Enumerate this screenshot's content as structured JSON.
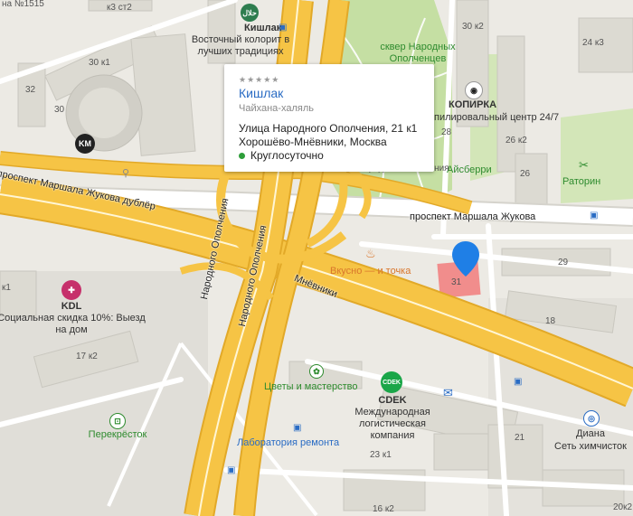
{
  "popup": {
    "title": "Кишлак",
    "category": "Чайхана-халяль",
    "address_line1": "Улица Народного Ополчения, 21 к1",
    "address_line2": "Хорошёво-Мнёвники, Москва",
    "hours": "Круглосуточно",
    "rating_stars": "★★★★★"
  },
  "roads": {
    "marshala_zhukova": "проспект Маршала Жукова",
    "marshala_zhukova_dubler": "проспект Маршала Жукова дублёр",
    "narodnogo_opolcheniya_1": "Народного Ополчения",
    "narodnogo_opolcheniya_2": "Народного Ополчения",
    "mnevniki": "Мнёвники",
    "marshala_left": "проспект Маршала Жукова дублёр"
  },
  "pois": {
    "kishlak": "Кишлак",
    "kishlak_sub1": "Восточный колорит в",
    "kishlak_sub2": "лучших традициях",
    "halal": "حلال",
    "skver": "сквер Народных",
    "skver2": "Ополченцев",
    "kopirka": "КОПИРКА",
    "kopirka_sub": "пилировальный центр 24/7",
    "aisberri": "Айсберри",
    "opolchentsev": "Народного ополчения",
    "ratorin": "Раторин",
    "vkusno": "Вкусно — и точка",
    "kdl": "KDL",
    "kdl_sub1": "Социальная скидка 10%: Выезд",
    "kdl_sub2": "на дом",
    "perekrestok": "Перекрёсток",
    "tsvety": "Цветы и мастерство",
    "cdek": "CDEK",
    "cdek_sub1": "Международная",
    "cdek_sub2": "логистическая",
    "cdek_sub3": "компания",
    "laboratoriya": "Лаборатория ремонта",
    "diana": "Диана",
    "diana_sub": "Сеть химчисток",
    "km": "KM",
    "cdek_logo": "СDEK"
  },
  "house_numbers": {
    "n1515": "на №1515",
    "h30k3": "30 к3",
    "h30k1": "30 к1",
    "h32": "32",
    "h30": "30",
    "h30k2": "30 к2",
    "h24k3": "24 к3",
    "h26k2": "26 к2",
    "h28": "28",
    "h26": "26",
    "h29": "29",
    "h18": "18",
    "h31": "31",
    "h17k2": "17 к2",
    "h21": "21",
    "h23k1": "23 к1",
    "h16k2": "16 к2",
    "hk1": "к1",
    "h20k2": "20к2",
    "hst2": "к3 ст2"
  },
  "colors": {
    "highway": "#f6c445",
    "highway_edge": "#e2a928",
    "street": "#ffffff",
    "park": "#c5dfa3",
    "building": "#dcdad2",
    "marker": "#1f7fe6",
    "highlight": "#f27c7c"
  }
}
